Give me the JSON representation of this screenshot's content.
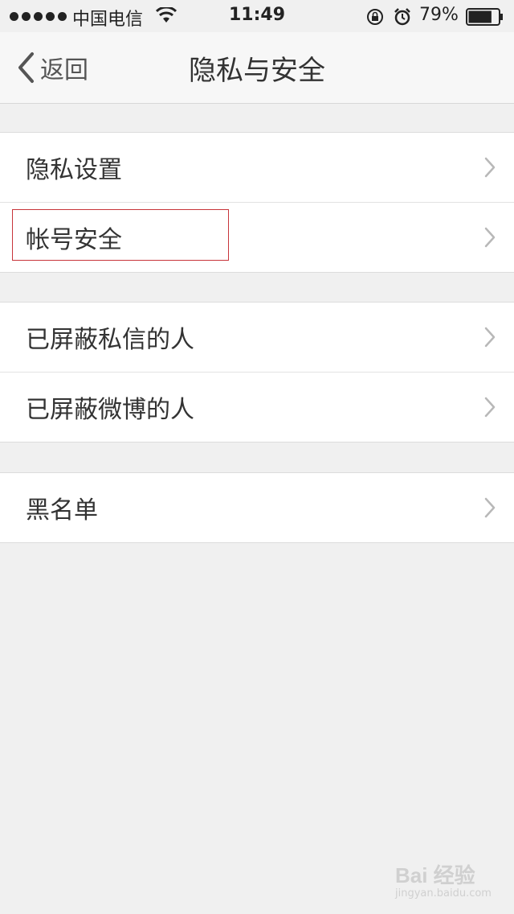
{
  "status_bar": {
    "carrier": "中国电信",
    "time": "11:49",
    "battery": "79%",
    "battery_level": 0.79
  },
  "nav": {
    "back_label": "返回",
    "title": "隐私与安全"
  },
  "groups": [
    {
      "items": [
        {
          "label": "隐私设置"
        },
        {
          "label": "帐号安全",
          "highlighted": true
        }
      ]
    },
    {
      "items": [
        {
          "label": "已屏蔽私信的人"
        },
        {
          "label": "已屏蔽微博的人"
        }
      ]
    },
    {
      "items": [
        {
          "label": "黑名单"
        }
      ]
    }
  ],
  "watermark": {
    "main": "Bai 经验",
    "sub": "jingyan.baidu.com"
  },
  "icons": {
    "back": "chevron-left-icon",
    "row": "chevron-right-icon",
    "wifi": "wifi-icon",
    "lock": "rotation-lock-icon",
    "alarm": "alarm-icon",
    "battery": "battery-icon"
  },
  "colors": {
    "highlight": "#c7343a",
    "background": "#f0f0f0"
  }
}
